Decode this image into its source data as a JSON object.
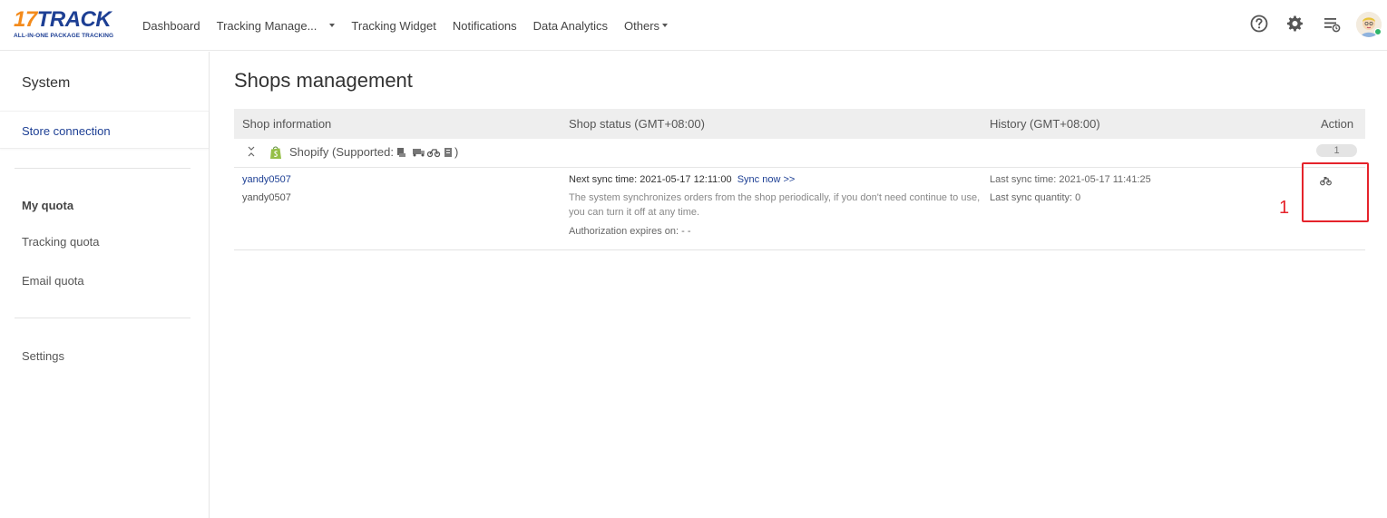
{
  "brand": {
    "logo_17": "17",
    "logo_track": "TRACK",
    "logo_sub": "ALL-IN-ONE PACKAGE TRACKING"
  },
  "nav": {
    "items": [
      {
        "label": "Dashboard"
      },
      {
        "label": "Tracking Manage..."
      },
      {
        "label": "Tracking Widget"
      },
      {
        "label": "Notifications"
      },
      {
        "label": "Data Analytics"
      },
      {
        "label": "Others"
      }
    ]
  },
  "top_icons": [
    "help-icon",
    "gear-icon",
    "task-list-icon",
    "user-avatar"
  ],
  "sidebar": {
    "title": "System",
    "active_item": "Store connection",
    "group_title": "My quota",
    "quota_items": [
      "Tracking quota",
      "Email quota"
    ],
    "settings": "Settings"
  },
  "main": {
    "title": "Shops management",
    "columns": [
      "Shop information",
      "Shop status (GMT+08:00)",
      "History (GMT+08:00)",
      "Action"
    ],
    "group": {
      "platform": "Shopify",
      "supported_prefix": "(Supported:",
      "supported_suffix": ")",
      "supported_icons": [
        "payment-icon",
        "truck-icon",
        "motorbike-icon",
        "document-icon"
      ],
      "count": "1"
    },
    "shop": {
      "name": "yandy0507",
      "account": "yandy0507",
      "next_sync_label": "Next sync time: 2021-05-17 12:11:00",
      "sync_now": "Sync now >>",
      "description_line1": "The system synchronizes orders from the shop periodically, if you don't need continue to use,",
      "description_line2": "you can turn it off at any time.",
      "auth_expires": "Authorization expires on: - -",
      "last_sync_time": "Last sync time: 2021-05-17 11:41:25",
      "last_sync_quantity": "Last sync quantity: 0",
      "action_icon": "motorbike-icon"
    },
    "annotation": "1"
  },
  "colors": {
    "brand_blue": "#1d3f94",
    "brand_orange": "#f38b1c",
    "highlight_red": "#e5232b",
    "online_green": "#2fb56a"
  }
}
